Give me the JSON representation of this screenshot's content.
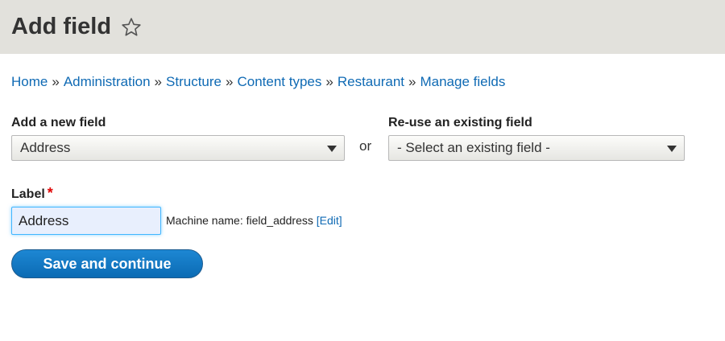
{
  "header": {
    "title": "Add field",
    "star_icon": "star-outline-icon"
  },
  "breadcrumb": {
    "items": [
      "Home",
      "Administration",
      "Structure",
      "Content types",
      "Restaurant",
      "Manage fields"
    ],
    "separator": "»"
  },
  "add_new_field": {
    "label": "Add a new field",
    "selected": "Address"
  },
  "or_text": "or",
  "reuse_field": {
    "label": "Re-use an existing field",
    "selected": "- Select an existing field -"
  },
  "label_field": {
    "label": "Label",
    "required_marker": "*",
    "value": "Address",
    "machine_name_prefix": "Machine name: field_address",
    "edit_link": "[Edit]"
  },
  "save_button": {
    "label": "Save and continue"
  },
  "colors": {
    "header_bg": "#e2e1dc",
    "link": "#0f6ab4",
    "primary_button": "#1d87d3",
    "required": "#e00000"
  }
}
